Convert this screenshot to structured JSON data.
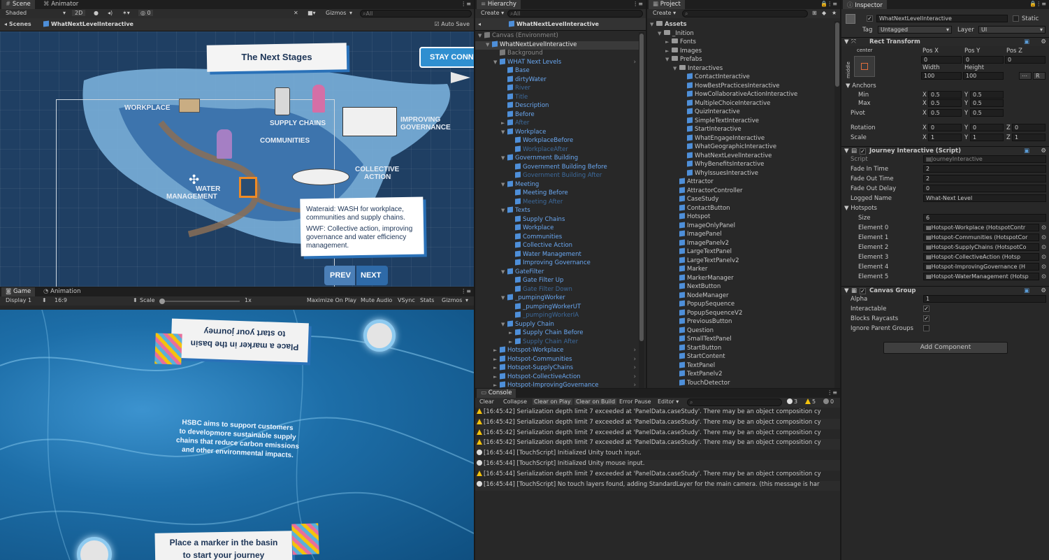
{
  "scene": {
    "tabs": [
      "Scene",
      "Animator"
    ],
    "toolbar": {
      "shading": "Shaded",
      "mode2d": "2D",
      "fx_count": "0",
      "gizmos": "Gizmos",
      "search": "All"
    },
    "breadcrumb": {
      "root": "Scenes",
      "object": "WhatNextLevelInteractive",
      "autosave": "Auto Save"
    },
    "canvas": {
      "title": "The Next Stages",
      "stay": "STAY CONN",
      "labels": {
        "workplace": "WORKPLACE",
        "supply": "SUPPLY CHAINS",
        "improving1": "IMPROVING",
        "improving2": "GOVERNANCE",
        "communities": "COMMUNITIES",
        "collective1": "COLLECTIVE",
        "collective2": "ACTION",
        "water1": "WATER",
        "water2": "MANAGEMENT"
      },
      "callout1": "Wateraid: WASH for workplace, communities and supply chains.",
      "callout2": "WWF: Collective action, improving governance and water efficiency management.",
      "prev": "PREV",
      "next": "NEXT"
    }
  },
  "game": {
    "tabs": [
      "Game",
      "Animation"
    ],
    "toolbar": {
      "display": "Display 1",
      "aspect": "16:9",
      "scale_label": "Scale",
      "scale_value": "1x",
      "maximize": "Maximize On Play",
      "mute": "Mute Audio",
      "vsync": "VSync",
      "stats": "Stats",
      "gizmos": "Gizmos"
    },
    "top_card1": "Place a marker in the basin",
    "top_card2": "to start your journey",
    "center1": "HSBC aims to support customers",
    "center2": "to developmore sustainable supply",
    "center3": "chains that reduce carbon emissions",
    "center4": "and other environmental impacts.",
    "bottom_card1": "Place a marker in the basin",
    "bottom_card2": "to start your journey"
  },
  "hierarchy": {
    "tab": "Hierarchy",
    "create": "Create",
    "search": "All",
    "header": "WhatNextLevelInteractive",
    "rows": [
      {
        "label": "Canvas (Environment)",
        "indent": 0,
        "arrow": "▼",
        "color": "#8a8a8a",
        "icon": "grey"
      },
      {
        "label": "WhatNextLevelInteractive",
        "indent": 1,
        "arrow": "▼",
        "color": "#e6e6e6",
        "icon": "blue",
        "selected": true
      },
      {
        "label": "Background",
        "indent": 2,
        "arrow": "",
        "color": "#8a8a8a",
        "icon": "grey"
      },
      {
        "label": "WHAT Next Levels",
        "indent": 2,
        "arrow": "▼",
        "color": "#6aa8f2",
        "icon": "blue"
      },
      {
        "label": "Base",
        "indent": 3,
        "arrow": "",
        "color": "#6aa8f2",
        "icon": "blue"
      },
      {
        "label": "dirtyWater",
        "indent": 3,
        "arrow": "",
        "color": "#6aa8f2",
        "icon": "blue"
      },
      {
        "label": "River",
        "indent": 3,
        "arrow": "",
        "color": "#3d6b9e",
        "icon": "blue"
      },
      {
        "label": "Title",
        "indent": 3,
        "arrow": "",
        "color": "#3d6b9e",
        "icon": "blue"
      },
      {
        "label": "Description",
        "indent": 3,
        "arrow": "",
        "color": "#6aa8f2",
        "icon": "blue"
      },
      {
        "label": "Before",
        "indent": 3,
        "arrow": "",
        "color": "#6aa8f2",
        "icon": "blue"
      },
      {
        "label": "After",
        "indent": 3,
        "arrow": "►",
        "color": "#3d6b9e",
        "icon": "blue"
      },
      {
        "label": "Workplace",
        "indent": 3,
        "arrow": "▼",
        "color": "#6aa8f2",
        "icon": "blue"
      },
      {
        "label": "WorkplaceBefore",
        "indent": 4,
        "arrow": "",
        "color": "#6aa8f2",
        "icon": "blue"
      },
      {
        "label": "WorkplaceAfter",
        "indent": 4,
        "arrow": "",
        "color": "#3d6b9e",
        "icon": "blue"
      },
      {
        "label": "Government Building",
        "indent": 3,
        "arrow": "▼",
        "color": "#6aa8f2",
        "icon": "blue"
      },
      {
        "label": "Government Building Before",
        "indent": 4,
        "arrow": "",
        "color": "#6aa8f2",
        "icon": "blue"
      },
      {
        "label": "Government Building After",
        "indent": 4,
        "arrow": "",
        "color": "#3d6b9e",
        "icon": "blue"
      },
      {
        "label": "Meeting",
        "indent": 3,
        "arrow": "▼",
        "color": "#6aa8f2",
        "icon": "blue"
      },
      {
        "label": "Meeting Before",
        "indent": 4,
        "arrow": "",
        "color": "#6aa8f2",
        "icon": "blue"
      },
      {
        "label": "Meeting After",
        "indent": 4,
        "arrow": "",
        "color": "#3d6b9e",
        "icon": "blue"
      },
      {
        "label": "Texts",
        "indent": 3,
        "arrow": "▼",
        "color": "#6aa8f2",
        "icon": "blue"
      },
      {
        "label": "Supply Chains",
        "indent": 4,
        "arrow": "",
        "color": "#6aa8f2",
        "icon": "blue"
      },
      {
        "label": "Workplace",
        "indent": 4,
        "arrow": "",
        "color": "#6aa8f2",
        "icon": "blue"
      },
      {
        "label": "Communities",
        "indent": 4,
        "arrow": "",
        "color": "#6aa8f2",
        "icon": "blue"
      },
      {
        "label": "Collective Action",
        "indent": 4,
        "arrow": "",
        "color": "#6aa8f2",
        "icon": "blue"
      },
      {
        "label": "Water Management",
        "indent": 4,
        "arrow": "",
        "color": "#6aa8f2",
        "icon": "blue"
      },
      {
        "label": "Improving Governance",
        "indent": 4,
        "arrow": "",
        "color": "#6aa8f2",
        "icon": "blue"
      },
      {
        "label": "GateFilter",
        "indent": 3,
        "arrow": "▼",
        "color": "#6aa8f2",
        "icon": "blue"
      },
      {
        "label": "Gate Filter Up",
        "indent": 4,
        "arrow": "",
        "color": "#6aa8f2",
        "icon": "blue"
      },
      {
        "label": "Gate Filter Down",
        "indent": 4,
        "arrow": "",
        "color": "#3d6b9e",
        "icon": "blue"
      },
      {
        "label": "_pumpingWorker",
        "indent": 3,
        "arrow": "▼",
        "color": "#6aa8f2",
        "icon": "blue"
      },
      {
        "label": "_pumpingWorkerUT",
        "indent": 4,
        "arrow": "",
        "color": "#6aa8f2",
        "icon": "blue"
      },
      {
        "label": "_pumpingWorkerIA",
        "indent": 4,
        "arrow": "",
        "color": "#3d6b9e",
        "icon": "blue"
      },
      {
        "label": "Supply Chain",
        "indent": 3,
        "arrow": "▼",
        "color": "#6aa8f2",
        "icon": "blue"
      },
      {
        "label": "Supply Chain Before",
        "indent": 4,
        "arrow": "►",
        "color": "#6aa8f2",
        "icon": "blue"
      },
      {
        "label": "Supply Chain After",
        "indent": 4,
        "arrow": "►",
        "color": "#3d6b9e",
        "icon": "blue"
      },
      {
        "label": "Hotspot-Workplace",
        "indent": 2,
        "arrow": "►",
        "color": "#6aa8f2",
        "icon": "blue"
      },
      {
        "label": "Hotspot-Communities",
        "indent": 2,
        "arrow": "►",
        "color": "#6aa8f2",
        "icon": "blue"
      },
      {
        "label": "Hotspot-SupplyChains",
        "indent": 2,
        "arrow": "►",
        "color": "#6aa8f2",
        "icon": "blue"
      },
      {
        "label": "Hotspot-CollectiveAction",
        "indent": 2,
        "arrow": "►",
        "color": "#6aa8f2",
        "icon": "blue"
      },
      {
        "label": "Hotspot-ImprovingGovernance",
        "indent": 2,
        "arrow": "►",
        "color": "#6aa8f2",
        "icon": "blue"
      }
    ]
  },
  "project": {
    "tab": "Project",
    "create": "Create",
    "header": "Assets",
    "folders": [
      {
        "label": "_Inition",
        "indent": 1,
        "arrow": "▼"
      },
      {
        "label": "Fonts",
        "indent": 2,
        "arrow": "►"
      },
      {
        "label": "Images",
        "indent": 2,
        "arrow": "►"
      },
      {
        "label": "Prefabs",
        "indent": 2,
        "arrow": "▼"
      },
      {
        "label": "Interactives",
        "indent": 3,
        "arrow": "▼"
      }
    ],
    "interactives": [
      "ContactInteractive",
      "HowBestPracticesInteractive",
      "HowCollaborativeActionInteractive",
      "MultipleChoiceInteractive",
      "QuizInteractive",
      "SimpleTextInteractive",
      "StartInteractive",
      "WhatEngageInteractive",
      "WhatGeographicInteractive",
      "WhatNextLevelInteractive",
      "WhyBenefitsInteractive",
      "WhyIssuesInteractive"
    ],
    "prefabs": [
      "Attractor",
      "AttractorController",
      "CaseStudy",
      "ContactButton",
      "Hotspot",
      "ImageOnlyPanel",
      "ImagePanel",
      "ImagePanelv2",
      "LargeTextPanel",
      "LargeTextPanelv2",
      "Marker",
      "MarkerManager",
      "NextButton",
      "NodeManager",
      "PopupSequence",
      "PopupSequenceV2",
      "PreviousButton",
      "Question",
      "SmallTextPanel",
      "StartButton",
      "StartContent",
      "TextPanel",
      "TextPanelv2",
      "TouchDetector"
    ]
  },
  "console": {
    "tab": "Console",
    "buttons": [
      "Clear",
      "Collapse",
      "Clear on Play",
      "Clear on Build",
      "Error Pause",
      "Editor"
    ],
    "counts": {
      "info": "3",
      "warn": "5",
      "error": "0"
    },
    "logs": [
      {
        "type": "warn",
        "text": "[16:45:42] Serialization depth limit 7 exceeded at 'PanelData.caseStudy'. There may be an object composition cy"
      },
      {
        "type": "warn",
        "text": "[16:45:42] Serialization depth limit 7 exceeded at 'PanelData.caseStudy'. There may be an object composition cy"
      },
      {
        "type": "warn",
        "text": "[16:45:42] Serialization depth limit 7 exceeded at 'PanelData.caseStudy'. There may be an object composition cy"
      },
      {
        "type": "warn",
        "text": "[16:45:42] Serialization depth limit 7 exceeded at 'PanelData.caseStudy'. There may be an object composition cy"
      },
      {
        "type": "info",
        "text": "[16:45:44] [TouchScript] Initialized Unity touch input."
      },
      {
        "type": "info",
        "text": "[16:45:44] [TouchScript] Initialized Unity mouse input."
      },
      {
        "type": "warn",
        "text": "[16:45:44] Serialization depth limit 7 exceeded at 'PanelData.caseStudy'. There may be an object composition cy"
      },
      {
        "type": "info",
        "text": "[16:45:44] [TouchScript] No touch layers found, adding StandardLayer for the main camera. (this message is har"
      }
    ]
  },
  "inspector": {
    "tab": "Inspector",
    "object_name": "WhatNextLevelInteractive",
    "static": "Static",
    "tag_label": "Tag",
    "tag": "Untagged",
    "layer_label": "Layer",
    "layer": "UI",
    "rect": {
      "title": "Rect Transform",
      "center": "center",
      "middle": "middle",
      "posx_l": "Pos X",
      "posy_l": "Pos Y",
      "posz_l": "Pos Z",
      "posx": "0",
      "posy": "0",
      "posz": "0",
      "width_l": "Width",
      "height_l": "Height",
      "width": "100",
      "height": "100",
      "r": "R",
      "anchors": "Anchors",
      "min": "Min",
      "max": "Max",
      "pivot": "Pivot",
      "x_l": "X",
      "y_l": "Y",
      "z_l": "Z",
      "min_x": "0.5",
      "min_y": "0.5",
      "max_x": "0.5",
      "max_y": "0.5",
      "pivot_x": "0.5",
      "pivot_y": "0.5",
      "rotation": "Rotation",
      "rot_x": "0",
      "rot_y": "0",
      "rot_z": "0",
      "scale": "Scale",
      "sc_x": "1",
      "sc_y": "1",
      "sc_z": "1"
    },
    "journey": {
      "title": "Journey Interactive (Script)",
      "script_l": "Script",
      "script": "JourneyInteractive",
      "fadein_l": "Fade In Time",
      "fadein": "2",
      "fadeout_l": "Fade Out Time",
      "fadeout": "2",
      "delay_l": "Fade Out Delay",
      "delay": "0",
      "logged_l": "Logged Name",
      "logged": "What-Next Level",
      "hotspots": "Hotspots",
      "size_l": "Size",
      "size": "6",
      "elements": [
        {
          "label": "Element 0",
          "value": "Hotspot-Workplace (HotspotContr"
        },
        {
          "label": "Element 1",
          "value": "Hotspot-Communities (HotspotCor"
        },
        {
          "label": "Element 2",
          "value": "Hotspot-SupplyChains (HotspotCo"
        },
        {
          "label": "Element 3",
          "value": "Hotspot-CollectiveAction (Hotsp"
        },
        {
          "label": "Element 4",
          "value": "Hotspot-ImprovingGovernance (H"
        },
        {
          "label": "Element 5",
          "value": "Hotspot-WaterManagement (Hotsp"
        }
      ]
    },
    "canvas_group": {
      "title": "Canvas Group",
      "alpha_l": "Alpha",
      "alpha": "1",
      "inter_l": "Interactable",
      "blocks_l": "Blocks Raycasts",
      "ignore_l": "Ignore Parent Groups"
    },
    "add_component": "Add Component"
  }
}
